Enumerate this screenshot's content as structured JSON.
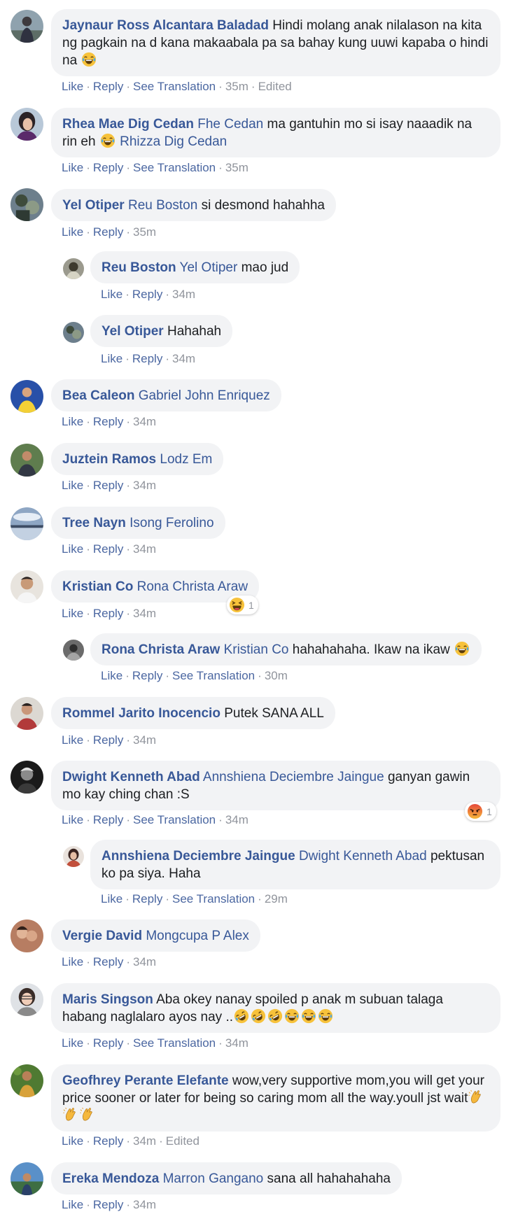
{
  "action_labels": {
    "like": "Like",
    "reply": "Reply",
    "translate": "See Translation",
    "edited": "Edited"
  },
  "comments": [
    {
      "author": "Jaynaur Ross Alcantara Baladad",
      "mention": "",
      "text": "Hindi molang anak nilalason na kita ng pagkain na d kana makaabala pa sa bahay kung uuwi kapaba o hindi na",
      "emoji": [
        "tears-of-joy"
      ],
      "time": "35m"
    },
    {
      "author": "Rhea Mae Dig Cedan",
      "mention": "Fhe Cedan",
      "text": "ma gantuhin mo si isay naaadik na rin eh",
      "emoji": [
        "tears-of-joy"
      ],
      "mention2": "Rhizza Dig Cedan",
      "time": "35m"
    },
    {
      "author": "Yel Otiper",
      "mention": "Reu Boston",
      "text": "si desmond hahahha",
      "time": "35m"
    },
    {
      "author": "Reu Boston",
      "mention": "Yel Otiper",
      "text": "mao jud",
      "time": "34m"
    },
    {
      "author": "Yel Otiper",
      "mention": "",
      "text": "Hahahah",
      "time": "34m"
    },
    {
      "author": "Bea Caleon",
      "mention": "Gabriel John Enriquez",
      "text": "",
      "time": "34m"
    },
    {
      "author": "Juztein Ramos",
      "mention": "Lodz Em",
      "text": "",
      "time": "34m"
    },
    {
      "author": "Tree Nayn",
      "mention": "Isong Ferolino",
      "text": "",
      "time": "34m"
    },
    {
      "author": "Kristian Co",
      "mention": "Rona Christa Araw",
      "text": "",
      "time": "34m",
      "reaction": {
        "type": "haha",
        "count": "1"
      }
    },
    {
      "author": "Rona Christa Araw",
      "mention": "Kristian Co",
      "text": "hahahahaha. Ikaw na ikaw",
      "emoji": [
        "tears-of-joy"
      ],
      "time": "30m"
    },
    {
      "author": "Rommel Jarito Inocencio",
      "mention": "",
      "text": "Putek SANA ALL",
      "time": "34m"
    },
    {
      "author": "Dwight Kenneth Abad",
      "mention": "Annshiena Deciembre Jaingue",
      "text": "ganyan gawin mo kay ching chan :S",
      "time": "34m",
      "reaction": {
        "type": "angry",
        "count": "1"
      }
    },
    {
      "author": "Annshiena Deciembre Jaingue",
      "mention": "Dwight Kenneth Abad",
      "text": "pektusan ko pa siya. Haha",
      "time": "29m"
    },
    {
      "author": "Vergie David",
      "mention": "Mongcupa P Alex",
      "text": "",
      "time": "34m"
    },
    {
      "author": "Maris Singson",
      "mention": "",
      "text": "Aba okey nanay spoiled p anak m subuan talaga habang naglalaro ayos nay ..",
      "emoji": [
        "rofl",
        "rofl",
        "rofl",
        "tears-of-joy",
        "tears-of-joy",
        "tears-of-joy"
      ],
      "time": "34m"
    },
    {
      "author": "Geofhrey Perante Elefante",
      "mention": "",
      "text": "wow,very supportive mom,you will get your price sooner or later for being so caring mom all the way.youll jst wait",
      "emoji": [
        "clapping-hands",
        "clapping-hands",
        "clapping-hands"
      ],
      "time": "34m"
    },
    {
      "author": "Ereka Mendoza",
      "mention": "Marron Gangano",
      "text": "sana all hahahahaha",
      "time": "34m"
    }
  ],
  "colors": {
    "author": "#385898",
    "action_link": "#4b67a1",
    "meta": "#90949c",
    "bubble": "#f2f3f5"
  }
}
